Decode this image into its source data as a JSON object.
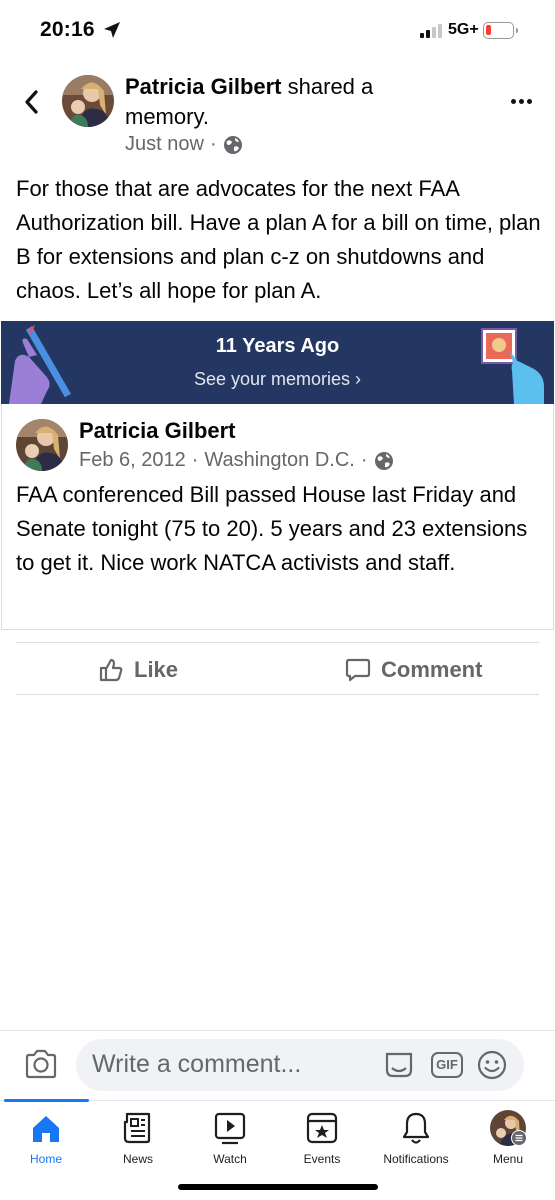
{
  "status_bar": {
    "time": "20:16",
    "network": "5G+"
  },
  "header": {
    "author_name": "Patricia Gilbert",
    "action_text": "shared a memory.",
    "time": "Just now",
    "separator": "·"
  },
  "post": {
    "text": "For those that are advocates for the next  FAA Authorization bill.  Have a plan A for a bill on time, plan B for extensions and plan c-z on shutdowns and chaos.  Let’s all hope for plan A."
  },
  "memory_banner": {
    "title": "11 Years Ago",
    "link": "See your memories ›"
  },
  "memory_post": {
    "author_name": "Patricia Gilbert",
    "date": "Feb 6, 2012",
    "location": "Washington D.C.",
    "separator": "·",
    "text": "FAA conferenced Bill passed House last Friday and Senate tonight (75 to 20).   5 years and 23 extensions to get it.  Nice work NATCA activists and staff."
  },
  "actions": {
    "like": "Like",
    "comment": "Comment"
  },
  "comment_bar": {
    "placeholder": "Write a comment...",
    "gif": "GIF"
  },
  "tabs": [
    {
      "label": "Home",
      "icon": "home-icon",
      "active": true
    },
    {
      "label": "News",
      "icon": "news-icon"
    },
    {
      "label": "Watch",
      "icon": "watch-icon"
    },
    {
      "label": "Events",
      "icon": "events-icon"
    },
    {
      "label": "Notifications",
      "icon": "bell-icon"
    },
    {
      "label": "Menu",
      "icon": "profile-avatar"
    }
  ],
  "colors": {
    "brand": "#1877f2",
    "banner": "#243762",
    "muted": "#65676b"
  }
}
